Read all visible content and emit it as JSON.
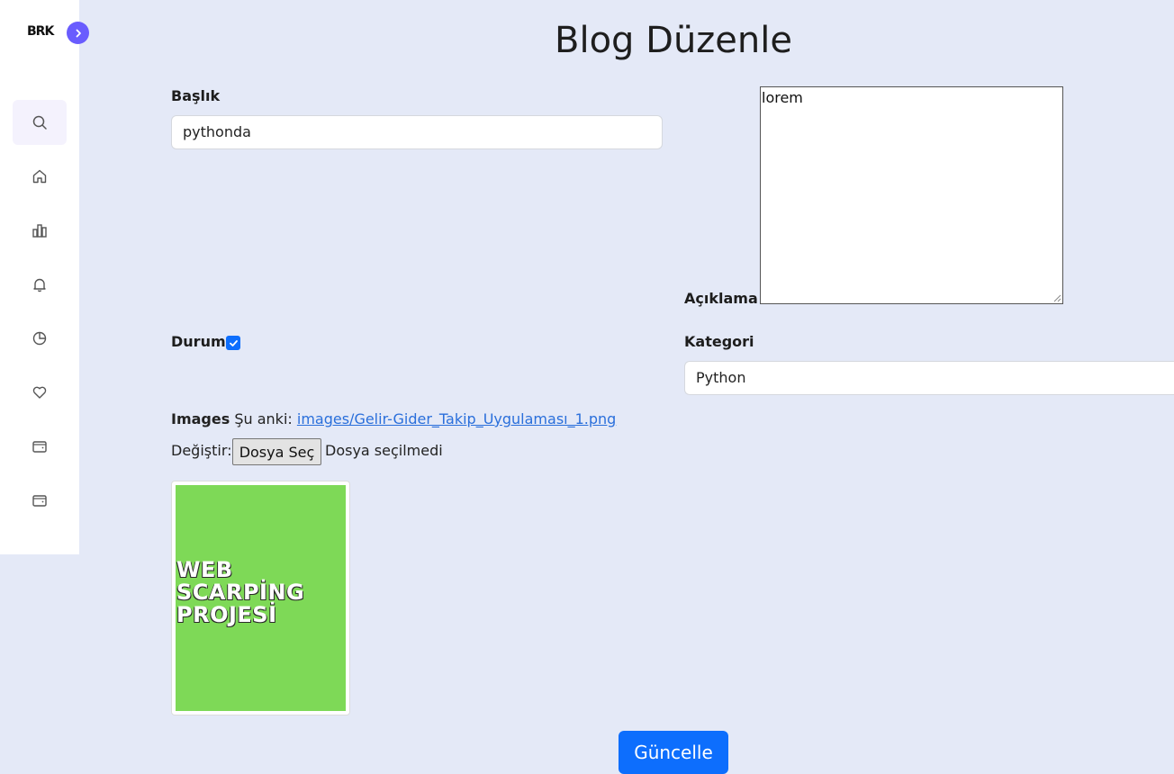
{
  "sidebar": {
    "logo": "BRK",
    "items": [
      {
        "icon": "search-icon"
      },
      {
        "icon": "home-icon"
      },
      {
        "icon": "bar-chart-icon"
      },
      {
        "icon": "bell-icon"
      },
      {
        "icon": "pie-chart-icon"
      },
      {
        "icon": "heart-icon"
      },
      {
        "icon": "wallet-icon"
      },
      {
        "icon": "wallet-icon"
      }
    ]
  },
  "page": {
    "title": "Blog Düzenle"
  },
  "form": {
    "title_label": "Başlık",
    "title_value": "pythonda",
    "description_label": "Açıklama",
    "description_value": "lorem",
    "status_label": "Durum",
    "status_checked": true,
    "category_label": "Kategori",
    "category_value": "Python",
    "images_label": "Images",
    "current_label": "Şu anki:",
    "current_file": "images/Gelir-Gider_Takip_Uygulaması_1.png",
    "change_label": "Değiştir:",
    "choose_file_button": "Dosya Seç",
    "no_file_text": "Dosya seçilmedi",
    "thumbnail_text": "WEB\nSCARPİNG\nPROJESİ",
    "submit_label": "Güncelle"
  },
  "colors": {
    "background": "#e4e9f7",
    "accent": "#695cfe",
    "primary_button": "#0d6efd",
    "thumbnail": "#7ed957"
  }
}
